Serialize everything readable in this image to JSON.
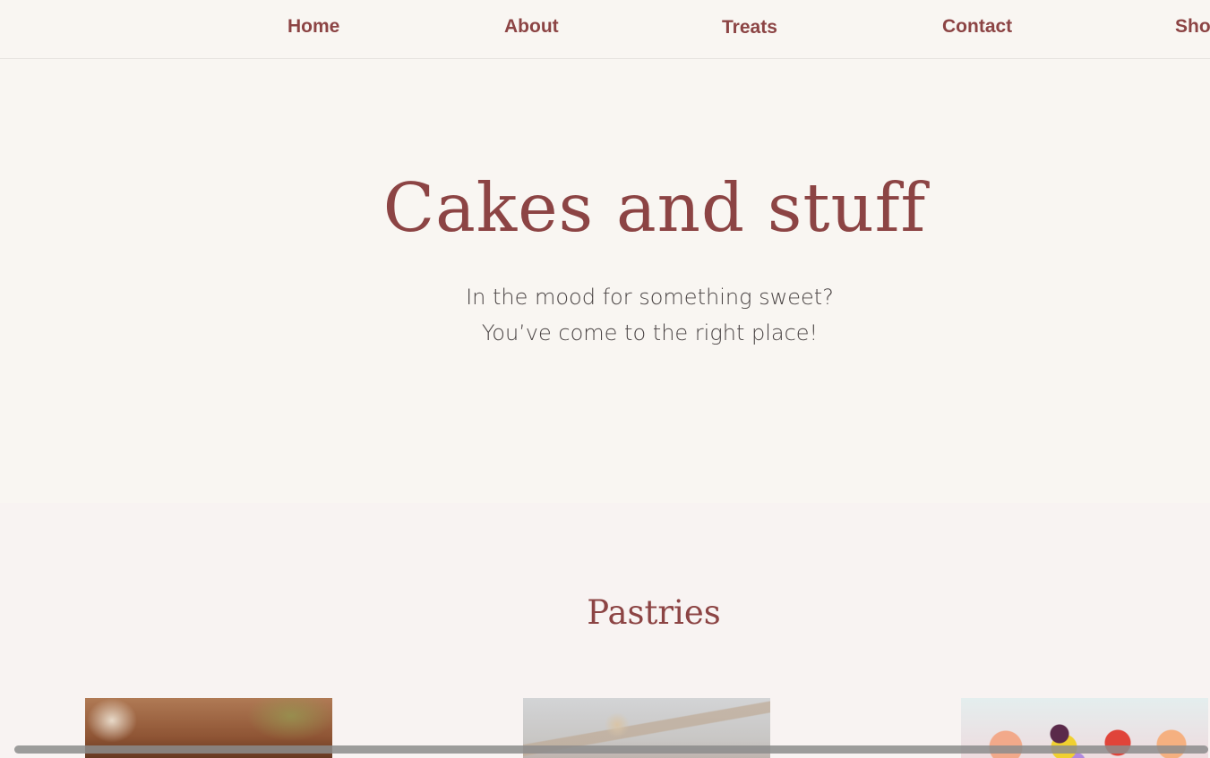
{
  "nav": {
    "items": [
      {
        "label": "Home"
      },
      {
        "label": "About"
      },
      {
        "label": "Treats"
      },
      {
        "label": "Contact"
      },
      {
        "label": "Sho"
      }
    ]
  },
  "hero": {
    "title": "Cakes and stuff",
    "subtitle_line1": "In the mood for something sweet?",
    "subtitle_line2": "You’ve come to the right place!"
  },
  "pastries": {
    "title": "Pastries",
    "images": [
      {
        "icon": "pastry-photo-1"
      },
      {
        "icon": "pastry-photo-2"
      },
      {
        "icon": "pastry-photo-3"
      }
    ]
  },
  "colors": {
    "accent": "#8c4444",
    "page_background": "#f9f6f2",
    "section_background": "#f8f3f2",
    "body_text": "#4a4444"
  }
}
